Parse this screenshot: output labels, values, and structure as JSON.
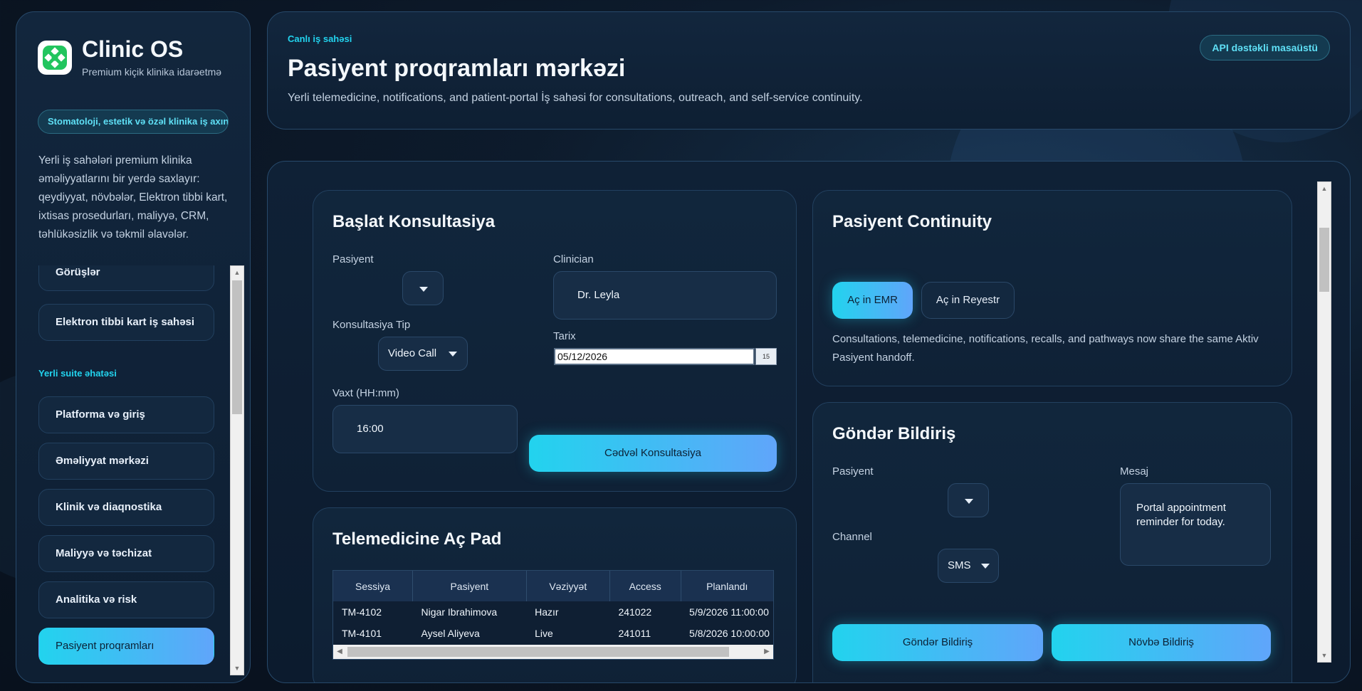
{
  "brand": {
    "title": "Clinic OS",
    "subtitle": "Premium kiçik klinika idarəetmə",
    "tag": "Stomatoloji, estetik və özəl klinika iş axını",
    "description": "Yerli iş sahələri premium klinika əməliyyatlarını bir yerdə saxlayır: qeydiyyat, növbələr, Elektron tibbi kart, ixtisas prosedurları, maliyyə, CRM, təhlükəsizlik və təkmil əlavələr."
  },
  "nav": {
    "items_top": [
      "Görüşlər",
      "Elektron tibbi kart iş sahəsi"
    ],
    "section_label": "Yerli suite əhatəsi",
    "items": [
      "Platforma və giriş",
      "Əməliyyat mərkəzi",
      "Klinik və diaqnostika",
      "Maliyyə və təchizat",
      "Analitika və risk",
      "Pasiyent proqramları"
    ],
    "active": "Pasiyent proqramları"
  },
  "header": {
    "eyebrow": "Canlı iş sahəsi",
    "title": "Pasiyent proqramları mərkəzi",
    "description": "Yerli telemedicine, notifications, and patient-portal İş sahəsi for consultations, outreach, and self-service continuity.",
    "badge": "API dəstəkli masaüstü"
  },
  "consultation": {
    "title": "Başlat Konsultasiya",
    "patient_label": "Pasiyent",
    "patient_value": "",
    "clinician_label": "Clinician",
    "clinician_value": "Dr. Leyla",
    "type_label": "Konsultasiya Tip",
    "type_value": "Video Call",
    "date_label": "Tarix",
    "date_value": "05/12/2026",
    "calendar_day": "15",
    "time_label": "Vaxt (HH:mm)",
    "time_value": "16:00",
    "schedule_button": "Cədvəl Konsultasiya"
  },
  "continuity": {
    "title": "Pasiyent Continuity",
    "open_emr": "Aç in EMR",
    "open_registry": "Aç in Reyestr",
    "note": "Consultations, telemedicine, notifications, recalls, and pathways now share the same Aktiv Pasiyent handoff."
  },
  "telemedicine": {
    "title": "Telemedicine Aç Pad",
    "columns": [
      "Sessiya",
      "Pasiyent",
      "Vəziyyət",
      "Access",
      "Planlandı"
    ],
    "rows": [
      [
        "TM-4102",
        "Nigar Ibrahimova",
        "Hazır",
        "241022",
        "5/9/2026 11:00:00"
      ],
      [
        "TM-4101",
        "Aysel Aliyeva",
        "Live",
        "241011",
        "5/8/2026 10:00:00"
      ]
    ]
  },
  "notification": {
    "title": "Göndər Bildiriş",
    "patient_label": "Pasiyent",
    "patient_value": "",
    "channel_label": "Channel",
    "channel_value": "SMS",
    "message_label": "Mesaj",
    "message_value": "Portal appointment reminder for today.",
    "send_button": "Göndər Bildiriş",
    "queue_button": "Növbə Bildiriş"
  },
  "colors": {
    "accent_start": "#22d3ee",
    "accent_end": "#60a5fa",
    "background": "#0a1422",
    "panel": "#12263d"
  }
}
